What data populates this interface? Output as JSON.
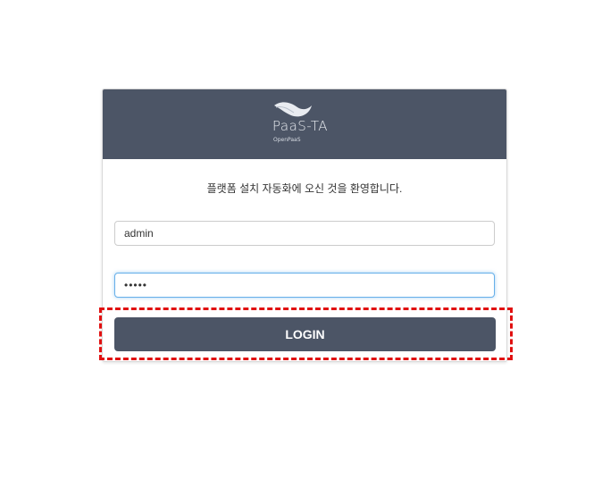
{
  "header": {
    "logo_text": "PaaS-TA",
    "logo_subtext": "OpenPaaS"
  },
  "welcome_message": "플랫폼 설치 자동화에 오신 것을 환영합니다.",
  "form": {
    "username_value": "admin",
    "password_value": "•••••",
    "login_label": "LOGIN"
  },
  "colors": {
    "header_bg": "#4c5566",
    "button_bg": "#4c5566",
    "highlight": "#e01010",
    "focus_border": "#66afe9"
  },
  "icons": {
    "logo": "paas-ta-logo-icon"
  }
}
